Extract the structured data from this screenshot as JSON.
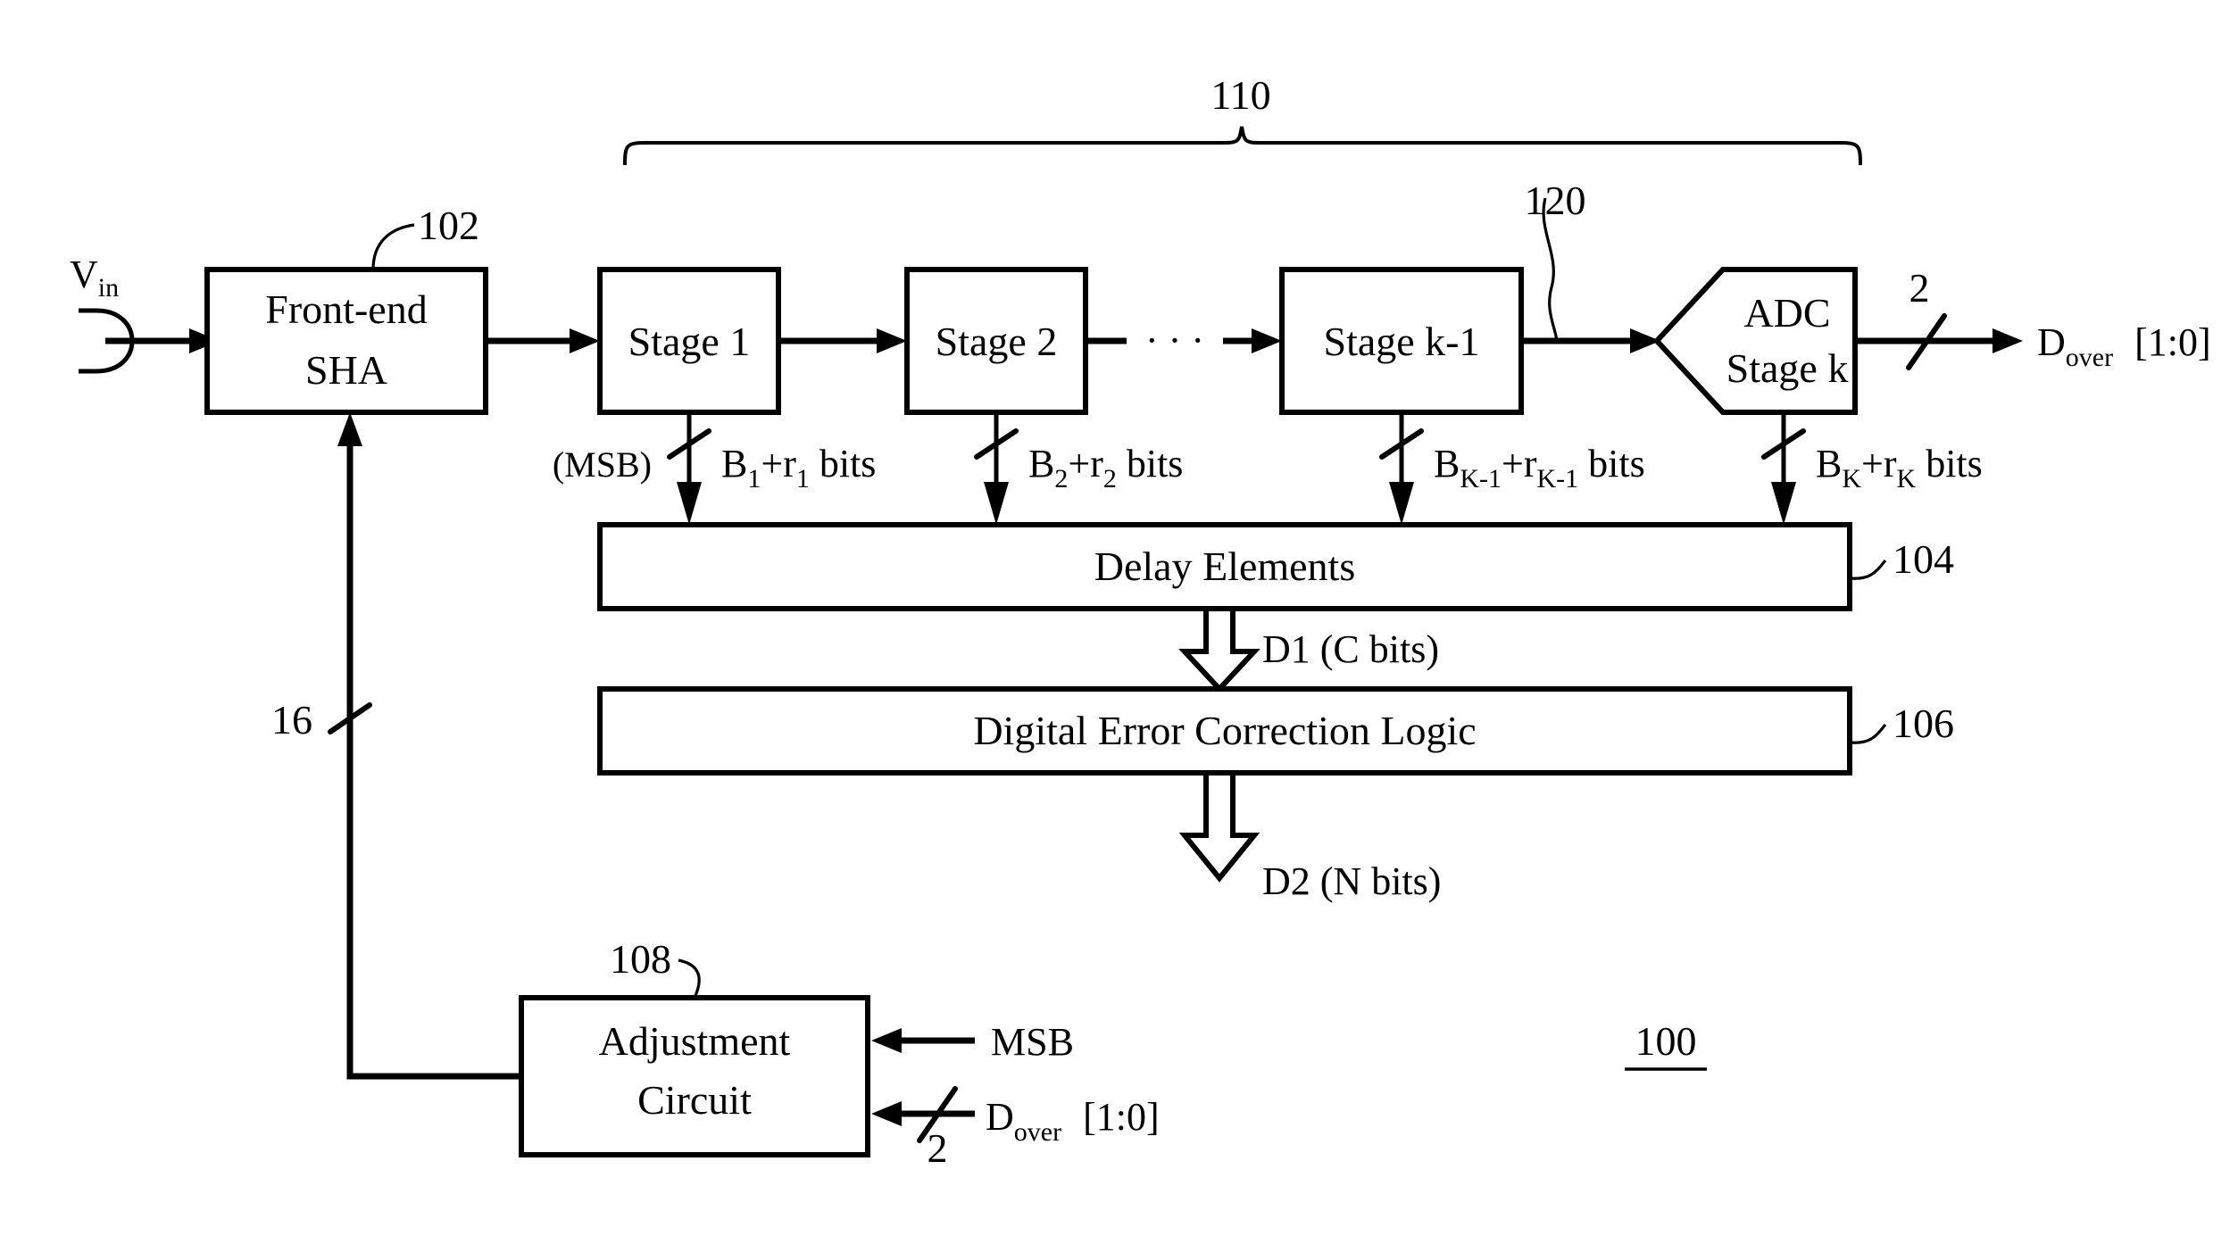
{
  "figure": {
    "figure_number": "100",
    "input_signal": "V",
    "input_signal_sub": "in",
    "blocks": [
      {
        "id": "sha",
        "label_line1": "Front-end",
        "label_line2": "SHA",
        "ref": "102"
      },
      {
        "id": "stage1",
        "label_line1": "Stage 1",
        "label_line2": "",
        "ref": ""
      },
      {
        "id": "stage2",
        "label_line1": "Stage 2",
        "label_line2": "",
        "ref": ""
      },
      {
        "id": "stagek1",
        "label_line1": "Stage k-1",
        "label_line2": "",
        "ref": ""
      },
      {
        "id": "adck",
        "label_line1": "ADC",
        "label_line2": "Stage k",
        "ref": ""
      },
      {
        "id": "delay",
        "label_line1": "Delay Elements",
        "label_line2": "",
        "ref": "104"
      },
      {
        "id": "decl",
        "label_line1": "Digital Error Correction Logic",
        "label_line2": "",
        "ref": "106"
      },
      {
        "id": "adjust",
        "label_line1": "Adjustment",
        "label_line2": "Circuit",
        "ref": "108"
      }
    ],
    "refs": {
      "sha": "102",
      "delay": "104",
      "correction": "106",
      "adjustment": "108",
      "pipeline_brace": "110",
      "stage_interconnect": "120",
      "system": "100"
    },
    "ellipsis": "· · ·",
    "bit_labels": [
      {
        "prefix": "(MSB)",
        "base": "B",
        "sub1": "1",
        "plus": "+",
        "base2": "r",
        "sub2": "1",
        "suffix": " bits"
      },
      {
        "prefix": "",
        "base": "B",
        "sub1": "2",
        "plus": "+",
        "base2": "r",
        "sub2": "2",
        "suffix": " bits"
      },
      {
        "prefix": "",
        "base": "B",
        "sub1": "K-1",
        "plus": "+",
        "base2": "r",
        "sub2": "K-1",
        "suffix": " bits"
      },
      {
        "prefix": "",
        "base": "B",
        "sub1": "K",
        "plus": "+",
        "base2": "r",
        "sub2": "K",
        "suffix": " bits"
      }
    ],
    "bus_widths": {
      "dover_out": "2",
      "dover_in": "2",
      "feedback": "16"
    },
    "signals": {
      "d1": "D1 (C bits)",
      "d2": "D2 (N bits)",
      "dover_name": "D",
      "dover_sub": "over",
      "dover_range": "[1:0]",
      "msb": "MSB"
    },
    "colors": {
      "ink": "#000000",
      "paper": "#ffffff"
    }
  }
}
